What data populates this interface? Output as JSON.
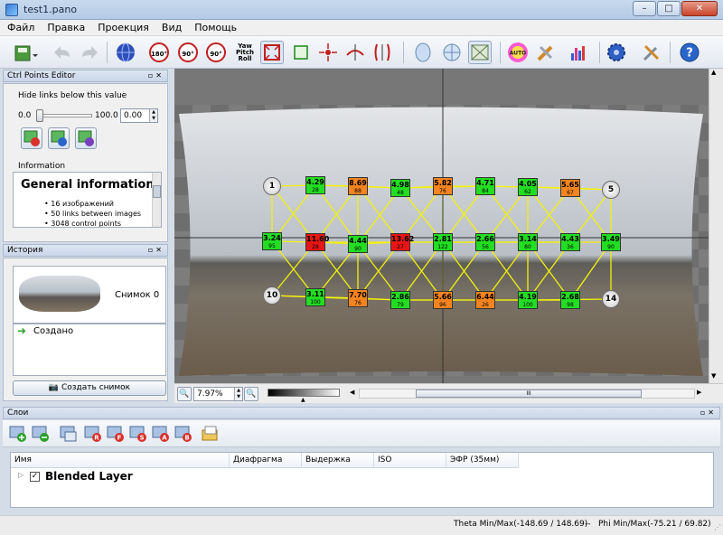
{
  "window": {
    "title": "test1.pano"
  },
  "menu": [
    "Файл",
    "Правка",
    "Проекция",
    "Вид",
    "Помощь"
  ],
  "toolbar": {
    "rotate180": "180°",
    "rotate90ccw": "90°",
    "rotate90cw": "90°",
    "ypr": [
      "Yaw",
      "Pitch",
      "Roll"
    ],
    "auto": "AUTO"
  },
  "ctrl_points_editor": {
    "title": "Ctrl Points Editor",
    "hide_links_label": "Hide links below this value",
    "min": "0.0",
    "max": "100.0",
    "value": "0.00",
    "info_label": "Information",
    "info_heading": "General information",
    "info_items": [
      "16 изображений",
      "50 links between images",
      "3048 control points"
    ]
  },
  "history": {
    "title": "История",
    "snapshot_label": "Снимок 0",
    "created_label": "Создано",
    "create_snapshot": "Создать снимок"
  },
  "viewer": {
    "zoom": "7.97%",
    "nodes": [
      {
        "label": "1"
      },
      {
        "label": "5"
      },
      {
        "label": "10"
      },
      {
        "label": "14"
      }
    ],
    "links": [
      {
        "value": "4.29",
        "count": "28",
        "status": "good"
      },
      {
        "value": "8.69",
        "count": "88",
        "status": "warn"
      },
      {
        "value": "4.98",
        "count": "48",
        "status": "good"
      },
      {
        "value": "5.82",
        "count": "76",
        "status": "warn"
      },
      {
        "value": "4.71",
        "count": "84",
        "status": "good"
      },
      {
        "value": "4.05",
        "count": "62",
        "status": "good"
      },
      {
        "value": "5.65",
        "count": "67",
        "status": "warn"
      },
      {
        "value": "3.24",
        "count": "95",
        "status": "good"
      },
      {
        "value": "11.60",
        "count": "28",
        "status": "bad"
      },
      {
        "value": "4.44",
        "count": "90",
        "status": "good"
      },
      {
        "value": "13.62",
        "count": "27",
        "status": "bad"
      },
      {
        "value": "2.81",
        "count": "122",
        "status": "good"
      },
      {
        "value": "2.66",
        "count": "56",
        "status": "good"
      },
      {
        "value": "3.14",
        "count": "80",
        "status": "good"
      },
      {
        "value": "4.43",
        "count": "36",
        "status": "good"
      },
      {
        "value": "3.49",
        "count": "90",
        "status": "good"
      },
      {
        "value": "3.11",
        "count": "100",
        "status": "good"
      },
      {
        "value": "7.70",
        "count": "76",
        "status": "warn"
      },
      {
        "value": "2.86",
        "count": "79",
        "status": "good"
      },
      {
        "value": "5.66",
        "count": "96",
        "status": "warn"
      },
      {
        "value": "6.44",
        "count": "26",
        "status": "warn"
      },
      {
        "value": "4.19",
        "count": "100",
        "status": "good"
      },
      {
        "value": "2.68",
        "count": "98",
        "status": "good"
      }
    ],
    "hscroll_grip": "III"
  },
  "layers": {
    "title": "Слои",
    "columns": [
      "Имя",
      "Диафрагма",
      "Выдержка",
      "ISO",
      "ЭФР (35мм)"
    ],
    "rows": [
      {
        "name": "Blended Layer",
        "checked": true
      }
    ],
    "button_letters": [
      "R",
      "F",
      "S",
      "A",
      "B"
    ]
  },
  "status": {
    "theta": "Theta Min/Max(-148.69 / 148.69)",
    "sep": "--",
    "phi": "Phi Min/Max(-75.21 / 69.82)"
  },
  "colors": {
    "good": "#22dd22",
    "warn": "#f5841f",
    "bad": "#e81515",
    "link_line": "#f2f20a"
  }
}
